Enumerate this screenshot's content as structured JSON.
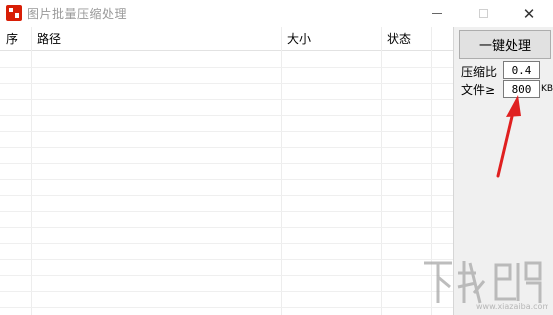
{
  "window": {
    "title": "图片批量压缩处理",
    "icon": "app-logo-icon",
    "controls": {
      "minimize": "minimize-icon",
      "maximize": "maximize-icon",
      "close": "✕"
    }
  },
  "table": {
    "columns": [
      "序",
      "路径",
      "大小",
      "状态"
    ],
    "rows": []
  },
  "panel": {
    "process_button": "一键处理",
    "ratio_label": "压缩比",
    "ratio_value": "0.4",
    "file_label": "文件≥",
    "file_value": "800",
    "file_unit": "KB"
  },
  "annotation": {
    "arrow_color": "#e02020"
  },
  "watermark": {
    "text": "下载吧",
    "color": "#9a9a9a"
  }
}
